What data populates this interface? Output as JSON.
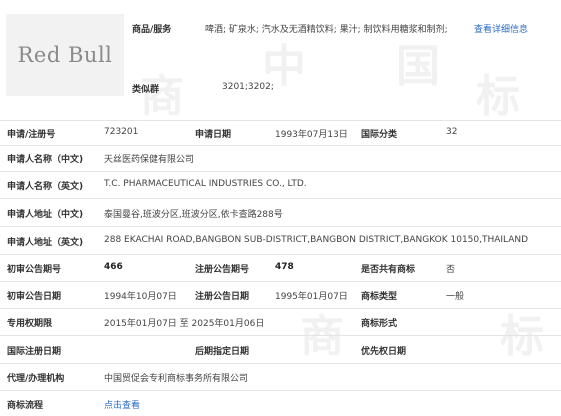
{
  "logo": {
    "text": "Red Bull"
  },
  "goods": {
    "label": "商品/服务",
    "value": "啤酒; 矿泉水; 汽水及无酒精饮料; 果汁; 制饮料用糖浆和制剂;",
    "link": "查看详细信息"
  },
  "similar_group": {
    "label": "类似群",
    "value": "3201;3202;"
  },
  "application_no": {
    "label": "申请/注册号",
    "value": "723201"
  },
  "application_date": {
    "label": "申请日期",
    "value": "1993年07月13日"
  },
  "intl_class": {
    "label": "国际分类",
    "value": "32"
  },
  "applicant_cn": {
    "label": "申请人名称（中文)",
    "value": "天丝医药保健有限公司"
  },
  "applicant_en": {
    "label": "申请人名称（英文)",
    "value": "T.C. PHARMACEUTICAL INDUSTRIES CO., LTD."
  },
  "address_cn": {
    "label": "申请人地址（中文)",
    "value": "泰国曼谷,班波分区,班波分区,依卡查路288号"
  },
  "address_en": {
    "label": "申请人地址（英文)",
    "value": "288 EKACHAI ROAD,BANGBON SUB-DISTRICT,BANGBON DISTRICT,BANGKOK 10150,THAILAND"
  },
  "prelim_pub_no": {
    "label": "初审公告期号",
    "value": "466"
  },
  "reg_pub_no": {
    "label": "注册公告期号",
    "value": "478"
  },
  "shared": {
    "label": "是否共有商标",
    "value": "否"
  },
  "prelim_pub_date": {
    "label": "初审公告日期",
    "value": "1994年10月07日"
  },
  "reg_pub_date": {
    "label": "注册公告日期",
    "value": "1995年01月07日"
  },
  "mark_type": {
    "label": "商标类型",
    "value": "一般"
  },
  "exclusive_period": {
    "label": "专用权期限",
    "value": "2015年01月07日 至 2025年01月06日"
  },
  "mark_form": {
    "label": "商标形式",
    "value": ""
  },
  "intl_reg_date": {
    "label": "国际注册日期",
    "value": ""
  },
  "later_designation_date": {
    "label": "后期指定日期",
    "value": ""
  },
  "priority_date": {
    "label": "优先权日期",
    "value": ""
  },
  "agent": {
    "label": "代理/办理机构",
    "value": "中国贸促会专利商标事务所有限公司"
  },
  "process": {
    "label": "商标流程",
    "link": "点击查看"
  },
  "watermark": [
    "中",
    "国",
    "商",
    "标"
  ]
}
